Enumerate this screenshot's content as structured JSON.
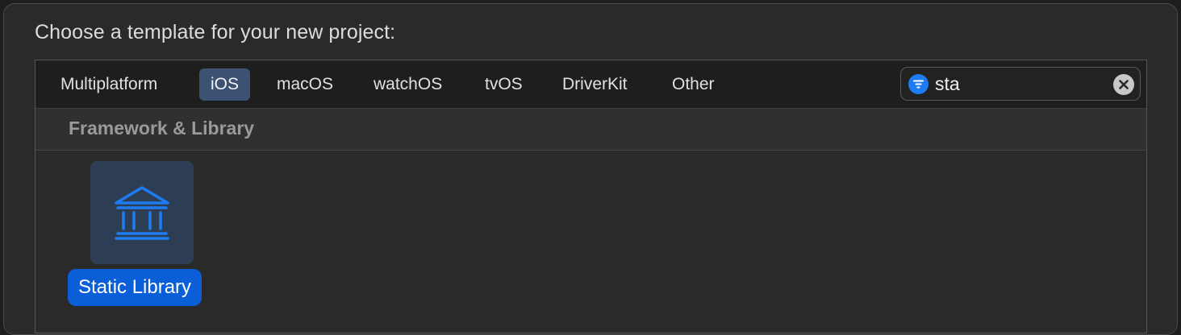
{
  "dialog": {
    "heading": "Choose a template for your new project:"
  },
  "tabs": [
    {
      "label": "Multiplatform",
      "selected": false
    },
    {
      "label": "iOS",
      "selected": true
    },
    {
      "label": "macOS",
      "selected": false
    },
    {
      "label": "watchOS",
      "selected": false
    },
    {
      "label": "tvOS",
      "selected": false
    },
    {
      "label": "DriverKit",
      "selected": false
    },
    {
      "label": "Other",
      "selected": false
    }
  ],
  "search": {
    "value": "sta",
    "icon": "filter-icon",
    "clear_icon": "clear-icon"
  },
  "section": {
    "title": "Framework & Library"
  },
  "templates": [
    {
      "label": "Static Library",
      "icon": "building-columns-icon",
      "selected": true
    }
  ],
  "colors": {
    "accent": "#0a5ed7",
    "icon_blue": "#1e7cf2",
    "selected_tab": "#3c5272"
  }
}
